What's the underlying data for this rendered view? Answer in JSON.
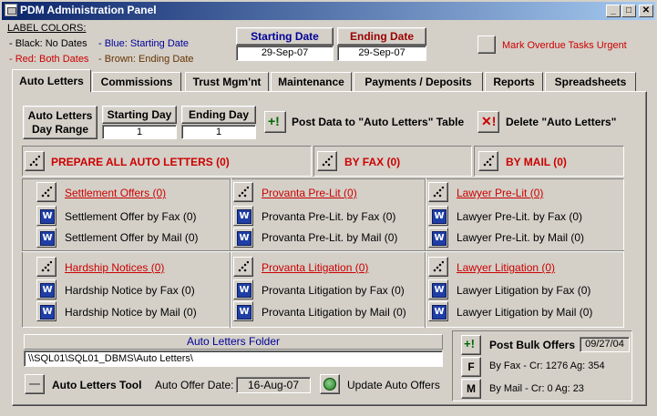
{
  "window": {
    "title": "PDM Administration Panel",
    "controls": {
      "minimize": "_",
      "maximize": "□",
      "close": "✕"
    }
  },
  "label_colors": {
    "heading": "LABEL COLORS:",
    "black": "- Black: No Dates",
    "red": "- Red: Both Dates",
    "blue": "- Blue: Starting Date",
    "brown": "- Brown: Ending Date"
  },
  "dates": {
    "start_label": "Starting Date",
    "start_value": "29-Sep-07",
    "end_label": "Ending Date",
    "end_value": "29-Sep-07"
  },
  "urgent": {
    "label": "Mark Overdue Tasks Urgent"
  },
  "tabs": [
    {
      "label": "Auto Letters",
      "active": true
    },
    {
      "label": "Commissions"
    },
    {
      "label": "Trust Mgm'nt"
    },
    {
      "label": "Maintenance"
    },
    {
      "label": "Payments / Deposits"
    },
    {
      "label": "Reports"
    },
    {
      "label": "Spreadsheets"
    }
  ],
  "range": {
    "button": "Auto Letters Day Range",
    "start_label": "Starting Day",
    "start_value": "1",
    "end_label": "Ending Day",
    "end_value": "1"
  },
  "actions": {
    "post": "Post Data to \"Auto Letters\" Table",
    "delete": "Delete \"Auto Letters\""
  },
  "prepare": {
    "all": "PREPARE ALL AUTO LETTERS (0)",
    "fax": "BY FAX (0)",
    "mail": "BY MAIL (0)"
  },
  "groups": {
    "settlement": {
      "title": "Settlement Offers (0)",
      "fax": "Settlement Offer by Fax (0)",
      "mail": "Settlement Offer by Mail (0)"
    },
    "provanta_prelit": {
      "title": "Provanta Pre-Lit (0)",
      "fax": "Provanta Pre-Lit. by Fax (0)",
      "mail": "Provanta Pre-Lit. by Mail (0)"
    },
    "lawyer_prelit": {
      "title": "Lawyer Pre-Lit (0)",
      "fax": "Lawyer Pre-Lit. by Fax (0)",
      "mail": "Lawyer Pre-Lit. by Mail (0)"
    },
    "hardship": {
      "title": "Hardship Notices (0)",
      "fax": "Hardship Notice by Fax (0)",
      "mail": "Hardship Notice by Mail (0)"
    },
    "provanta_lit": {
      "title": "Provanta Litigation (0)",
      "fax": "Provanta Litigation by Fax (0)",
      "mail": "Provanta Litigation by Mail (0)"
    },
    "lawyer_lit": {
      "title": "Lawyer Litigation (0)",
      "fax": "Lawyer Litigation by Fax (0)",
      "mail": "Lawyer Litigation by Mail (0)"
    }
  },
  "folder": {
    "label": "Auto Letters Folder",
    "path": "\\\\SQL01\\SQL01_DBMS\\Auto Letters\\"
  },
  "tool": {
    "label": "Auto Letters Tool",
    "offer_date_label": "Auto Offer Date:",
    "offer_date_value": "16-Aug-07",
    "update": "Update Auto Offers"
  },
  "bulk": {
    "label": "Post Bulk Offers",
    "date": "09/27/04",
    "fax_button": "F",
    "mail_button": "M",
    "fax_text": "By Fax - Cr: 1276 Ag: 354",
    "mail_text": "By Mail - Cr: 0 Ag: 23"
  }
}
